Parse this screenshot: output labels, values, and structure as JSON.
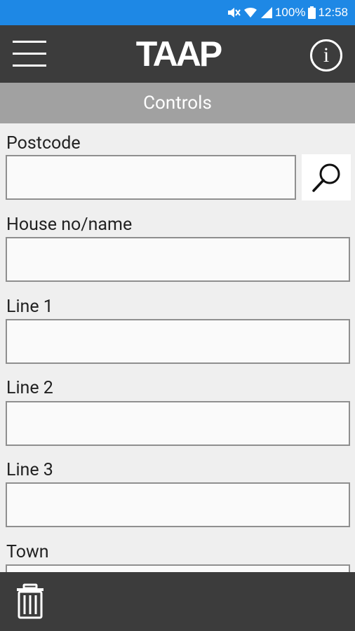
{
  "status_bar": {
    "battery": "100%",
    "time": "12:58",
    "icons": [
      "mute-icon",
      "wifi-icon",
      "signal-icon",
      "battery-icon"
    ]
  },
  "app_bar": {
    "title": "TAAP",
    "icons": [
      "menu-icon",
      "info-icon"
    ],
    "info_glyph": "i"
  },
  "subheader": {
    "title": "Controls"
  },
  "form": {
    "postcode_label": "Postcode",
    "postcode_value": "",
    "house_label": "House no/name",
    "house_value": "",
    "line1_label": "Line 1",
    "line1_value": "",
    "line2_label": "Line 2",
    "line2_value": "",
    "line3_label": "Line 3",
    "line3_value": "",
    "town_label": "Town",
    "town_value": ""
  },
  "bottom_bar": {
    "icons": [
      "trash-icon"
    ]
  },
  "colors": {
    "status_bar": "#1e88e5",
    "app_bar": "#3c3c3c",
    "subheader": "#a1a1a1",
    "background": "#efefef"
  }
}
